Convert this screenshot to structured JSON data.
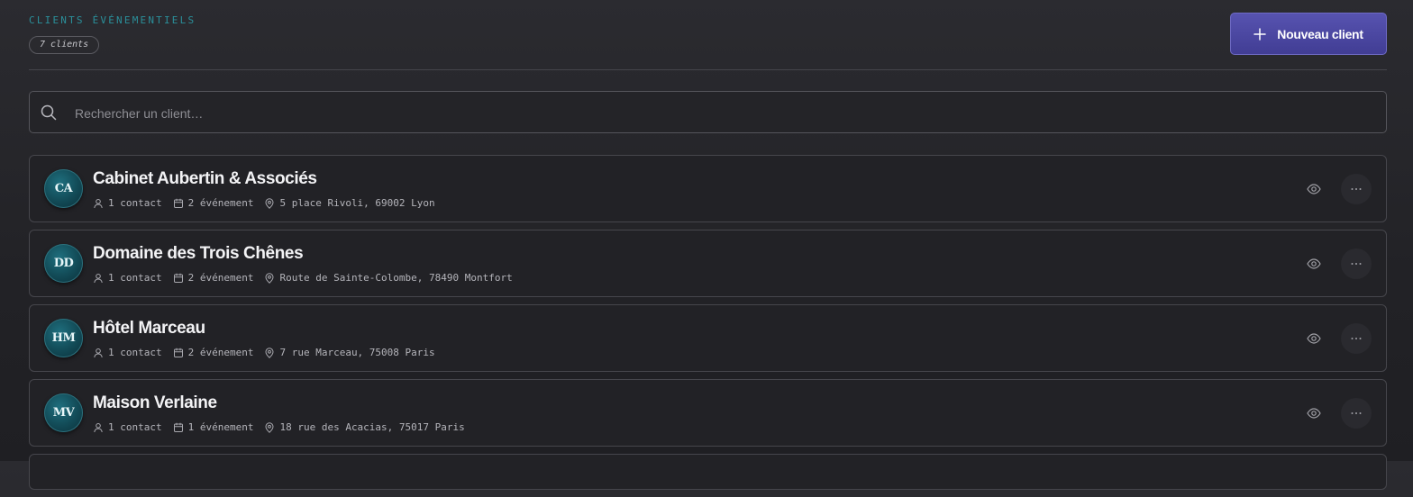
{
  "header": {
    "section_title": "CLIENTS ÉVÉNEMENTIELS",
    "count_badge": "7 clients",
    "new_button_label": "Nouveau client"
  },
  "search": {
    "placeholder": "Rechercher un client…",
    "value": ""
  },
  "clients": [
    {
      "initials": "CA",
      "name": "Cabinet Aubertin & Associés",
      "contacts": "1 contact",
      "events": "2 événement",
      "address": "5 place Rivoli, 69002 Lyon"
    },
    {
      "initials": "DD",
      "name": "Domaine des Trois Chênes",
      "contacts": "1 contact",
      "events": "2 événement",
      "address": "Route de Sainte-Colombe, 78490 Montfort"
    },
    {
      "initials": "HM",
      "name": "Hôtel Marceau",
      "contacts": "1 contact",
      "events": "2 événement",
      "address": "7 rue Marceau, 75008 Paris"
    },
    {
      "initials": "MV",
      "name": "Maison Verlaine",
      "contacts": "1 contact",
      "events": "1 événement",
      "address": "18 rue des Acacias, 75017 Paris"
    }
  ],
  "icons": {
    "add": "plus-icon",
    "search": "search-icon",
    "contact": "user-icon",
    "event": "calendar-icon",
    "address": "map-pin-icon",
    "view": "eye-icon",
    "more": "more-horizontal-icon"
  },
  "colors": {
    "accent": "#4a46a3",
    "section_title": "#2a8f9a",
    "avatar": "#145360",
    "background": "#242428"
  }
}
